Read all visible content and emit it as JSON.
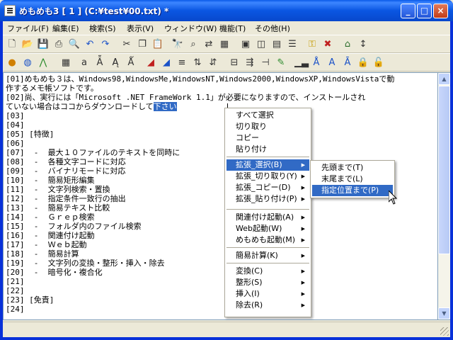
{
  "window": {
    "title": "めもめも3 [ 1 ] (C:¥test¥00.txt) *",
    "min_label": "_",
    "max_label": "□",
    "close_label": "×"
  },
  "menubar": [
    {
      "id": "file",
      "label": "ファイル(F)"
    },
    {
      "id": "edit",
      "label": "編集(E)"
    },
    {
      "id": "search",
      "label": "検索(S)"
    },
    {
      "id": "view",
      "label": "表示(V)"
    },
    {
      "id": "window",
      "label": "ウィンドウ(W)"
    },
    {
      "id": "function",
      "label": "機能(T)"
    },
    {
      "id": "other",
      "label": "その他(H)"
    }
  ],
  "editor": {
    "lines": [
      {
        "text": "[01]めもめも３は、Windows98,WindowsMe,WindowsNT,Windows2000,WindowsXP,WindowsVistaで動"
      },
      {
        "text": "作するメモ帳ソフトです。"
      },
      {
        "text": "[02]尚、実行には「Microsoft .NET FrameWork 1.1」が必要になりますので、インストールされ"
      },
      {
        "text": "ていない場合はココからダウンロードして",
        "selected": "下さい"
      },
      {
        "text": "[03]"
      },
      {
        "text": "[04]"
      },
      {
        "text": "[05] [特徴]"
      },
      {
        "text": "[06]"
      },
      {
        "text": "[07]  -  最大１０ファイルのテキストを同時に"
      },
      {
        "text": "[08]  -  各種文字コードに対応"
      },
      {
        "text": "[09]  -  バイナリモードに対応"
      },
      {
        "text": "[10]  -  簡易矩形編集"
      },
      {
        "text": "[11]  -  文字列検索・置換"
      },
      {
        "text": "[12]  -  指定条件一致行の抽出"
      },
      {
        "text": "[13]  -  簡易テキスト比較"
      },
      {
        "text": "[14]  -  Ｇｒｅｐ検索"
      },
      {
        "text": "[15]  -  フォルダ内のファイル検索"
      },
      {
        "text": "[16]  -  関連付け起動"
      },
      {
        "text": "[17]  -  Ｗｅｂ起動"
      },
      {
        "text": "[18]  -  簡易計算"
      },
      {
        "text": "[19]  -  文字列の変換・整形・挿入・除去"
      },
      {
        "text": "[20]  -  暗号化・複合化"
      },
      {
        "text": "[21]"
      },
      {
        "text": "[22]"
      },
      {
        "text": "[23] [免責]"
      },
      {
        "text": "[24]"
      }
    ]
  },
  "context_menu": {
    "items": [
      {
        "label": "すべて選択"
      },
      {
        "label": "切り取り"
      },
      {
        "label": "コピー"
      },
      {
        "label": "貼り付け"
      },
      {
        "label": "拡張_選択(B)",
        "submenu": true,
        "highlighted": true
      },
      {
        "label": "拡張_切り取り(Y)",
        "submenu": true
      },
      {
        "label": "拡張_コピー(D)",
        "submenu": true
      },
      {
        "label": "拡張_貼り付け(P)",
        "submenu": true
      },
      {
        "label": "関連付け起動(A)",
        "submenu": true
      },
      {
        "label": "Web起動(W)",
        "submenu": true
      },
      {
        "label": "めもめも起動(M)",
        "submenu": true
      },
      {
        "label": "簡易計算(K)",
        "submenu": true
      },
      {
        "label": "変換(C)",
        "submenu": true
      },
      {
        "label": "整形(S)",
        "submenu": true
      },
      {
        "label": "挿入(I)",
        "submenu": true
      },
      {
        "label": "除去(R)",
        "submenu": true
      }
    ]
  },
  "submenu": {
    "items": [
      {
        "label": "先頭まで(T)"
      },
      {
        "label": "末尾まで(L)"
      },
      {
        "label": "指定位置まで(P)",
        "highlighted": true
      }
    ]
  },
  "toolbar1": [
    "new-file-icon",
    "open-folder-icon",
    "save-icon",
    "print-icon",
    "print-preview-icon",
    "undo-icon",
    "redo-icon",
    "cut-icon",
    "copy-icon",
    "paste-icon",
    "find-icon",
    "find-next-icon",
    "replace-icon",
    "grid-icon",
    "tile-icon",
    "cascade-icon",
    "window-icon",
    "key-icon",
    "delete-icon",
    "home-icon",
    "updown-icon"
  ],
  "toolbar2": [
    "run-icon",
    "web-icon",
    "chart-icon",
    "calculator-icon",
    "convert-icon",
    "font-icon",
    "font-small-icon",
    "indent-icon",
    "outdent-icon",
    "sort-asc-icon",
    "sort-desc-icon",
    "table-icon",
    "merge-icon",
    "marker-icon",
    "bar-chart-icon",
    "align-icon",
    "text-icon",
    "text-alt-icon",
    "lock-icon",
    "unlock-icon"
  ],
  "colors": {
    "selection": "#316ac5",
    "titlebar": "#0a56e2"
  }
}
